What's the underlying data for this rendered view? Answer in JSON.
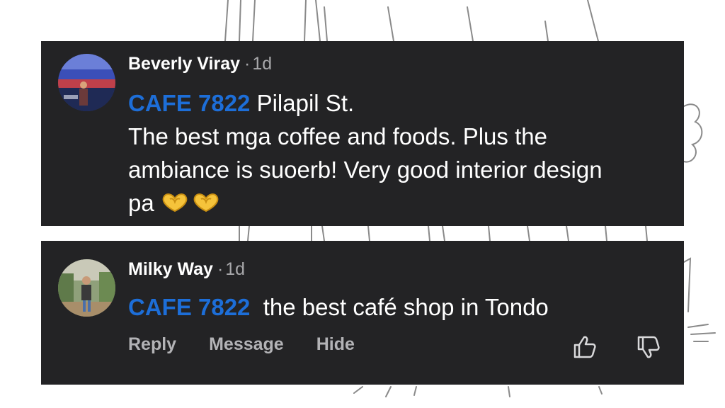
{
  "comments": [
    {
      "author": "Beverly Viray",
      "separator": "·",
      "time": "1d",
      "tag": "CAFE 7822",
      "line1": " Pilapil St.",
      "text": "The best mga coffee and foods. Plus the ambiance is suoerb! Very good interior design pa ",
      "emoji_icon": "heart-hands-icon"
    },
    {
      "author": "Milky Way",
      "separator": "·",
      "time": "1d",
      "tag": "CAFE 7822",
      "text": "  the best café shop in Tondo"
    }
  ],
  "actions": {
    "reply": "Reply",
    "message": "Message",
    "hide": "Hide",
    "like_icon": "thumbs-up-icon",
    "dislike_icon": "thumbs-down-icon"
  },
  "colors": {
    "card_bg": "#232325",
    "tag": "#1d6ed8",
    "muted": "#a8a8ab",
    "emoji": "#f5c33b"
  }
}
